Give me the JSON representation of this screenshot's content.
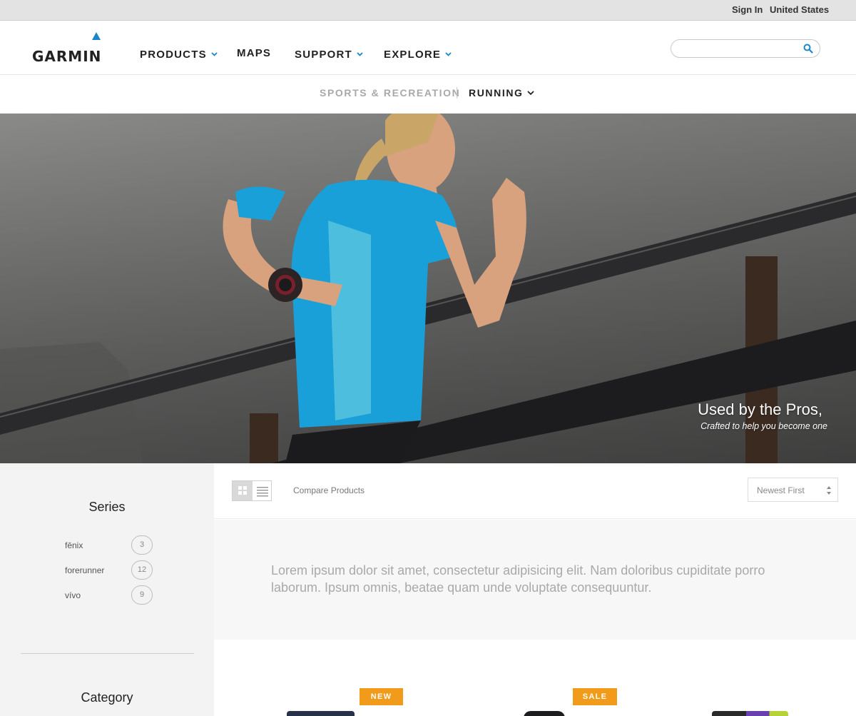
{
  "utility": {
    "sign_in": "Sign In",
    "region": "United States"
  },
  "brand": {
    "name": "GARMIN",
    "accent_color": "#1a86c8"
  },
  "nav": {
    "products": "PRODUCTS",
    "maps": "MAPS",
    "support": "SUPPORT",
    "explore": "EXPLORE"
  },
  "search": {
    "value": "",
    "icon": "search-icon"
  },
  "subnav": {
    "parent": "SPORTS & RECREATION",
    "current": "RUNNING"
  },
  "hero": {
    "headline": "Used by the Pros,",
    "subline": "Crafted to help you become one"
  },
  "sidebar": {
    "series_heading": "Series",
    "series": [
      {
        "label": "fēnix",
        "count": "3"
      },
      {
        "label": "forerunner",
        "count": "12"
      },
      {
        "label": "vívo",
        "count": "9"
      }
    ],
    "category_heading": "Category"
  },
  "toolbar": {
    "compare": "Compare Products",
    "sort": "Newest First",
    "view_grid_icon": "grid-view-icon",
    "view_list_icon": "list-view-icon"
  },
  "intro": {
    "text": "Lorem ipsum dolor sit amet, consectetur adipisicing elit. Nam doloribus cupiditate porro laborum. Ipsum omnis, beatae quam unde voluptate consequuntur."
  },
  "products": {
    "badges": [
      "NEW",
      "SALE"
    ],
    "badge_color": "#f29b1b"
  }
}
